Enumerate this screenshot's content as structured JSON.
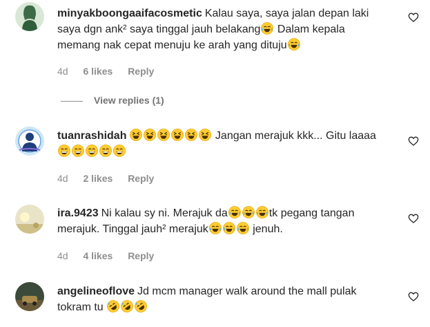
{
  "comments": [
    {
      "username": "minyakboongaaifacosmetic",
      "parts": [
        "Kalau saya, saya jalan depan laki saya dgn ank² saya tinggal jauh belakang",
        "Dalam kepala memang nak cepat menuju ke arah yang dituju"
      ],
      "time": "4d",
      "likes": "6 likes",
      "reply": "Reply",
      "view_replies": "View replies (1)"
    },
    {
      "username": "tuanrashidah",
      "parts": [
        "Jangan merajuk kkk... Gitu laaaa"
      ],
      "time": "4d",
      "likes": "2 likes",
      "reply": "Reply"
    },
    {
      "username": "ira.9423",
      "parts": [
        "Ni kalau sy ni. Merajuk da",
        "tk pegang tangan merajuk. Tinggal jauh² merajuk",
        "jenuh."
      ],
      "time": "4d",
      "likes": "4 likes",
      "reply": "Reply"
    },
    {
      "username": "angelineoflove",
      "parts": [
        "Jd mcm manager walk around the mall pulak tokram tu"
      ]
    }
  ],
  "icons": {
    "like": "heart-outline-icon",
    "emoji_tears": "face-with-tears-of-joy",
    "emoji_squint": "grinning-squinting-face",
    "emoji_grin": "beaming-face",
    "emoji_rofl": "rolling-on-floor-laughing"
  },
  "colors": {
    "text": "#262626",
    "muted": "#8e8e8e",
    "emoji": "#ffcc33"
  }
}
